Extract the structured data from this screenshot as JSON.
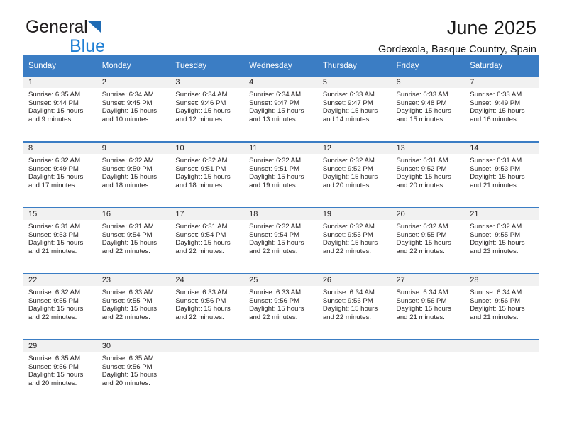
{
  "brand": {
    "name_primary": "General",
    "name_secondary": "Blue",
    "triangle_color": "#1f6bb4",
    "secondary_color": "#1f7fd4"
  },
  "header": {
    "title": "June 2025",
    "location": "Gordexola, Basque Country, Spain"
  },
  "theme": {
    "header_row_bg": "#3b7dc4",
    "header_row_text": "#ffffff",
    "daynum_band_bg": "#f1f1f1",
    "row_divider": "#3b7dc4",
    "body_text": "#231f20"
  },
  "labels": {
    "sunrise_prefix": "Sunrise:",
    "sunset_prefix": "Sunset:",
    "daylight_prefix": "Daylight:"
  },
  "weekday_headers": [
    "Sunday",
    "Monday",
    "Tuesday",
    "Wednesday",
    "Thursday",
    "Friday",
    "Saturday"
  ],
  "weeks": [
    [
      {
        "day": "1",
        "sunrise": "Sunrise: 6:35 AM",
        "sunset": "Sunset: 9:44 PM",
        "daylight_line1": "Daylight: 15 hours",
        "daylight_line2": "and 9 minutes."
      },
      {
        "day": "2",
        "sunrise": "Sunrise: 6:34 AM",
        "sunset": "Sunset: 9:45 PM",
        "daylight_line1": "Daylight: 15 hours",
        "daylight_line2": "and 10 minutes."
      },
      {
        "day": "3",
        "sunrise": "Sunrise: 6:34 AM",
        "sunset": "Sunset: 9:46 PM",
        "daylight_line1": "Daylight: 15 hours",
        "daylight_line2": "and 12 minutes."
      },
      {
        "day": "4",
        "sunrise": "Sunrise: 6:34 AM",
        "sunset": "Sunset: 9:47 PM",
        "daylight_line1": "Daylight: 15 hours",
        "daylight_line2": "and 13 minutes."
      },
      {
        "day": "5",
        "sunrise": "Sunrise: 6:33 AM",
        "sunset": "Sunset: 9:47 PM",
        "daylight_line1": "Daylight: 15 hours",
        "daylight_line2": "and 14 minutes."
      },
      {
        "day": "6",
        "sunrise": "Sunrise: 6:33 AM",
        "sunset": "Sunset: 9:48 PM",
        "daylight_line1": "Daylight: 15 hours",
        "daylight_line2": "and 15 minutes."
      },
      {
        "day": "7",
        "sunrise": "Sunrise: 6:33 AM",
        "sunset": "Sunset: 9:49 PM",
        "daylight_line1": "Daylight: 15 hours",
        "daylight_line2": "and 16 minutes."
      }
    ],
    [
      {
        "day": "8",
        "sunrise": "Sunrise: 6:32 AM",
        "sunset": "Sunset: 9:49 PM",
        "daylight_line1": "Daylight: 15 hours",
        "daylight_line2": "and 17 minutes."
      },
      {
        "day": "9",
        "sunrise": "Sunrise: 6:32 AM",
        "sunset": "Sunset: 9:50 PM",
        "daylight_line1": "Daylight: 15 hours",
        "daylight_line2": "and 18 minutes."
      },
      {
        "day": "10",
        "sunrise": "Sunrise: 6:32 AM",
        "sunset": "Sunset: 9:51 PM",
        "daylight_line1": "Daylight: 15 hours",
        "daylight_line2": "and 18 minutes."
      },
      {
        "day": "11",
        "sunrise": "Sunrise: 6:32 AM",
        "sunset": "Sunset: 9:51 PM",
        "daylight_line1": "Daylight: 15 hours",
        "daylight_line2": "and 19 minutes."
      },
      {
        "day": "12",
        "sunrise": "Sunrise: 6:32 AM",
        "sunset": "Sunset: 9:52 PM",
        "daylight_line1": "Daylight: 15 hours",
        "daylight_line2": "and 20 minutes."
      },
      {
        "day": "13",
        "sunrise": "Sunrise: 6:31 AM",
        "sunset": "Sunset: 9:52 PM",
        "daylight_line1": "Daylight: 15 hours",
        "daylight_line2": "and 20 minutes."
      },
      {
        "day": "14",
        "sunrise": "Sunrise: 6:31 AM",
        "sunset": "Sunset: 9:53 PM",
        "daylight_line1": "Daylight: 15 hours",
        "daylight_line2": "and 21 minutes."
      }
    ],
    [
      {
        "day": "15",
        "sunrise": "Sunrise: 6:31 AM",
        "sunset": "Sunset: 9:53 PM",
        "daylight_line1": "Daylight: 15 hours",
        "daylight_line2": "and 21 minutes."
      },
      {
        "day": "16",
        "sunrise": "Sunrise: 6:31 AM",
        "sunset": "Sunset: 9:54 PM",
        "daylight_line1": "Daylight: 15 hours",
        "daylight_line2": "and 22 minutes."
      },
      {
        "day": "17",
        "sunrise": "Sunrise: 6:31 AM",
        "sunset": "Sunset: 9:54 PM",
        "daylight_line1": "Daylight: 15 hours",
        "daylight_line2": "and 22 minutes."
      },
      {
        "day": "18",
        "sunrise": "Sunrise: 6:32 AM",
        "sunset": "Sunset: 9:54 PM",
        "daylight_line1": "Daylight: 15 hours",
        "daylight_line2": "and 22 minutes."
      },
      {
        "day": "19",
        "sunrise": "Sunrise: 6:32 AM",
        "sunset": "Sunset: 9:55 PM",
        "daylight_line1": "Daylight: 15 hours",
        "daylight_line2": "and 22 minutes."
      },
      {
        "day": "20",
        "sunrise": "Sunrise: 6:32 AM",
        "sunset": "Sunset: 9:55 PM",
        "daylight_line1": "Daylight: 15 hours",
        "daylight_line2": "and 22 minutes."
      },
      {
        "day": "21",
        "sunrise": "Sunrise: 6:32 AM",
        "sunset": "Sunset: 9:55 PM",
        "daylight_line1": "Daylight: 15 hours",
        "daylight_line2": "and 23 minutes."
      }
    ],
    [
      {
        "day": "22",
        "sunrise": "Sunrise: 6:32 AM",
        "sunset": "Sunset: 9:55 PM",
        "daylight_line1": "Daylight: 15 hours",
        "daylight_line2": "and 22 minutes."
      },
      {
        "day": "23",
        "sunrise": "Sunrise: 6:33 AM",
        "sunset": "Sunset: 9:55 PM",
        "daylight_line1": "Daylight: 15 hours",
        "daylight_line2": "and 22 minutes."
      },
      {
        "day": "24",
        "sunrise": "Sunrise: 6:33 AM",
        "sunset": "Sunset: 9:56 PM",
        "daylight_line1": "Daylight: 15 hours",
        "daylight_line2": "and 22 minutes."
      },
      {
        "day": "25",
        "sunrise": "Sunrise: 6:33 AM",
        "sunset": "Sunset: 9:56 PM",
        "daylight_line1": "Daylight: 15 hours",
        "daylight_line2": "and 22 minutes."
      },
      {
        "day": "26",
        "sunrise": "Sunrise: 6:34 AM",
        "sunset": "Sunset: 9:56 PM",
        "daylight_line1": "Daylight: 15 hours",
        "daylight_line2": "and 22 minutes."
      },
      {
        "day": "27",
        "sunrise": "Sunrise: 6:34 AM",
        "sunset": "Sunset: 9:56 PM",
        "daylight_line1": "Daylight: 15 hours",
        "daylight_line2": "and 21 minutes."
      },
      {
        "day": "28",
        "sunrise": "Sunrise: 6:34 AM",
        "sunset": "Sunset: 9:56 PM",
        "daylight_line1": "Daylight: 15 hours",
        "daylight_line2": "and 21 minutes."
      }
    ],
    [
      {
        "day": "29",
        "sunrise": "Sunrise: 6:35 AM",
        "sunset": "Sunset: 9:56 PM",
        "daylight_line1": "Daylight: 15 hours",
        "daylight_line2": "and 20 minutes."
      },
      {
        "day": "30",
        "sunrise": "Sunrise: 6:35 AM",
        "sunset": "Sunset: 9:56 PM",
        "daylight_line1": "Daylight: 15 hours",
        "daylight_line2": "and 20 minutes."
      },
      {
        "day": "",
        "sunrise": "",
        "sunset": "",
        "daylight_line1": "",
        "daylight_line2": ""
      },
      {
        "day": "",
        "sunrise": "",
        "sunset": "",
        "daylight_line1": "",
        "daylight_line2": ""
      },
      {
        "day": "",
        "sunrise": "",
        "sunset": "",
        "daylight_line1": "",
        "daylight_line2": ""
      },
      {
        "day": "",
        "sunrise": "",
        "sunset": "",
        "daylight_line1": "",
        "daylight_line2": ""
      },
      {
        "day": "",
        "sunrise": "",
        "sunset": "",
        "daylight_line1": "",
        "daylight_line2": ""
      }
    ]
  ]
}
